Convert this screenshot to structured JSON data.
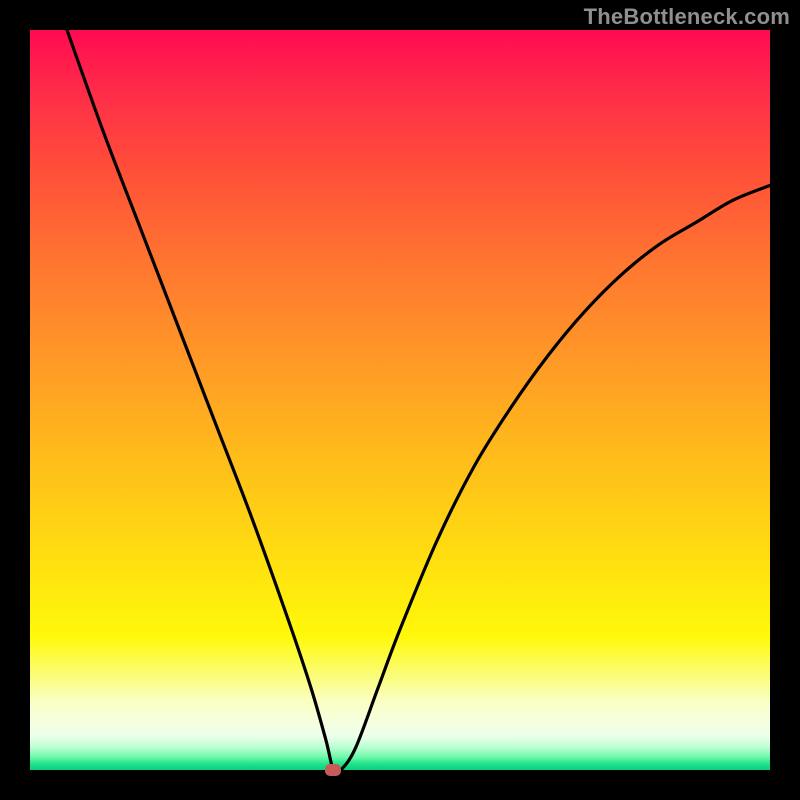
{
  "watermark": "TheBottleneck.com",
  "colors": {
    "frame": "#000000",
    "curve": "#000000",
    "marker": "#c85a5a",
    "watermark": "#8f8f8f"
  },
  "chart_data": {
    "type": "line",
    "title": "",
    "xlabel": "",
    "ylabel": "",
    "xlim": [
      0,
      100
    ],
    "ylim": [
      0,
      100
    ],
    "grid": false,
    "legend": false,
    "min_point": {
      "x": 41,
      "y": 0
    },
    "series": [
      {
        "name": "bottleneck-curve",
        "x": [
          5,
          10,
          15,
          20,
          25,
          30,
          35,
          38,
          40,
          41,
          42,
          44,
          47,
          50,
          55,
          60,
          65,
          70,
          75,
          80,
          85,
          90,
          95,
          100
        ],
        "y": [
          100,
          86,
          73,
          60,
          47,
          34,
          20,
          11,
          4,
          0,
          0,
          3,
          11,
          19,
          31,
          41,
          49,
          56,
          62,
          67,
          71,
          74,
          77,
          79
        ]
      }
    ]
  }
}
